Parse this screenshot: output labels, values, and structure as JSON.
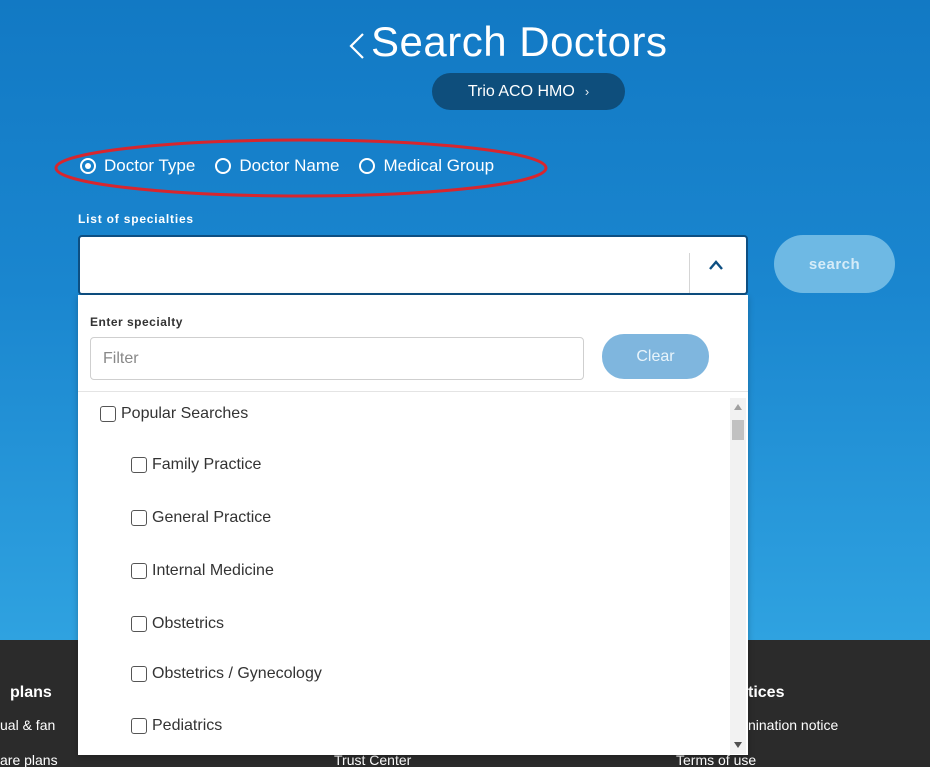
{
  "header": {
    "title": "Search Doctors",
    "plan": "Trio ACO HMO",
    "plan_chevron": "›"
  },
  "search_mode": {
    "options": [
      {
        "label": "Doctor Type",
        "checked": true
      },
      {
        "label": "Doctor Name",
        "checked": false
      },
      {
        "label": "Medical Group",
        "checked": false
      }
    ]
  },
  "specialties": {
    "label": "List of specialties",
    "selected_value": "",
    "search_label": "search"
  },
  "dropdown": {
    "enter_label": "Enter specialty",
    "filter_placeholder": "Filter",
    "filter_value": "",
    "clear_label": "Clear",
    "items": [
      {
        "label": "Popular Searches",
        "level": 0
      },
      {
        "label": "Family Practice",
        "level": 1
      },
      {
        "label": "General Practice",
        "level": 1
      },
      {
        "label": "Internal Medicine",
        "level": 1
      },
      {
        "label": "Obstetrics",
        "level": 1
      },
      {
        "label": "Obstetrics / Gynecology",
        "level": 1
      },
      {
        "label": "Pediatrics",
        "level": 1
      }
    ]
  },
  "footer": {
    "col1_heading": "plans",
    "col1_link1": "ual & fan",
    "col1_link2": "are plans",
    "col2_link": "Trust Center",
    "col3_heading": "tices",
    "col3_link1": "nination notice",
    "col3_link2": "Terms of use"
  },
  "colors": {
    "hero_top": "#1279c4",
    "hero_bottom": "#2fa2e0",
    "pill": "#0e4e7c",
    "annotation": "#d7262e",
    "footer": "#2b2b2b"
  }
}
